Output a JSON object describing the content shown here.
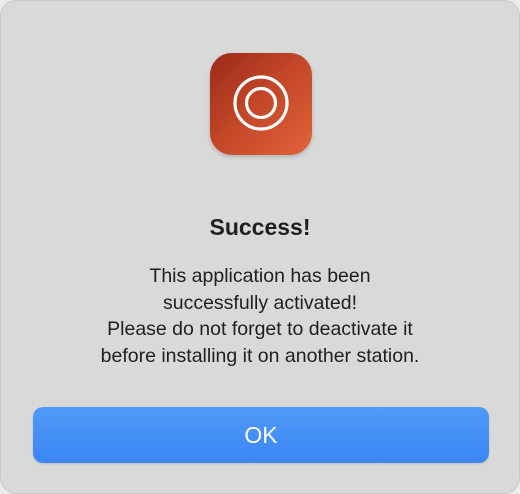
{
  "dialog": {
    "app_icon": "target-rings-icon",
    "title": "Success!",
    "message_lines": [
      "This application has been",
      "successfully activated!",
      "Please do not forget to deactivate it",
      "before installing it on another station."
    ],
    "ok_label": "OK"
  },
  "colors": {
    "dialog_background": "#d9d9d9",
    "icon_gradient_start": "#9a2a18",
    "icon_gradient_end": "#e2643a",
    "button_blue": "#3b86f5",
    "text": "#1f1f1f"
  }
}
